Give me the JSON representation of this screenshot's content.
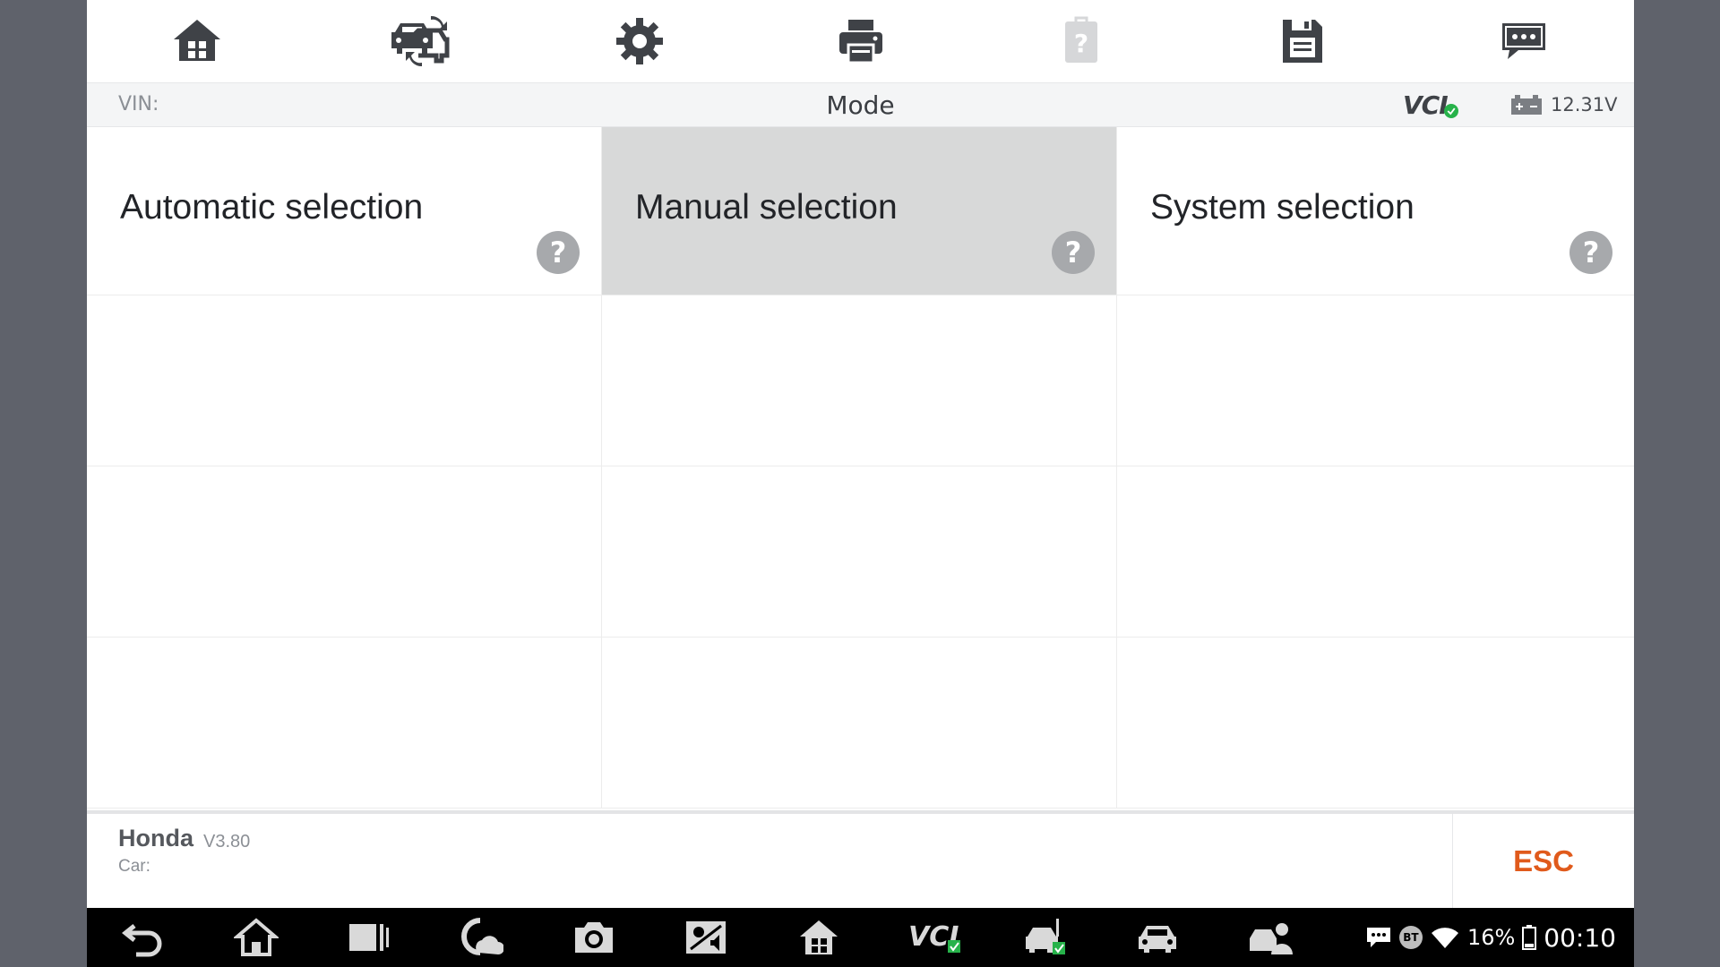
{
  "toolbar": {
    "buttons": [
      {
        "name": "home",
        "icon": "home-icon"
      },
      {
        "name": "change-vehicle",
        "icon": "cars-swap-icon"
      },
      {
        "name": "settings",
        "icon": "gear-icon"
      },
      {
        "name": "print",
        "icon": "printer-icon"
      },
      {
        "name": "help",
        "icon": "help-document-icon"
      },
      {
        "name": "save",
        "icon": "save-icon"
      },
      {
        "name": "feedback",
        "icon": "chat-icon"
      }
    ]
  },
  "infobar": {
    "vin_label": "VIN:",
    "title": "Mode",
    "vci_label": "VCI",
    "voltage": "12.31V"
  },
  "menu": {
    "items": [
      {
        "label": "Automatic selection",
        "help": "?"
      },
      {
        "label": "Manual selection",
        "help": "?",
        "selected": true
      },
      {
        "label": "System selection",
        "help": "?"
      }
    ]
  },
  "footer": {
    "make": "Honda",
    "version": "V3.80",
    "car_label": "Car:",
    "esc_label": "ESC"
  },
  "navbar": {
    "battery_percent": "16%",
    "time": "00:10",
    "bt_label": "BT"
  },
  "colors": {
    "accent_esc": "#e05a1b",
    "selected_cell": "#d8d9d9",
    "vci_ok": "#27b24a"
  }
}
